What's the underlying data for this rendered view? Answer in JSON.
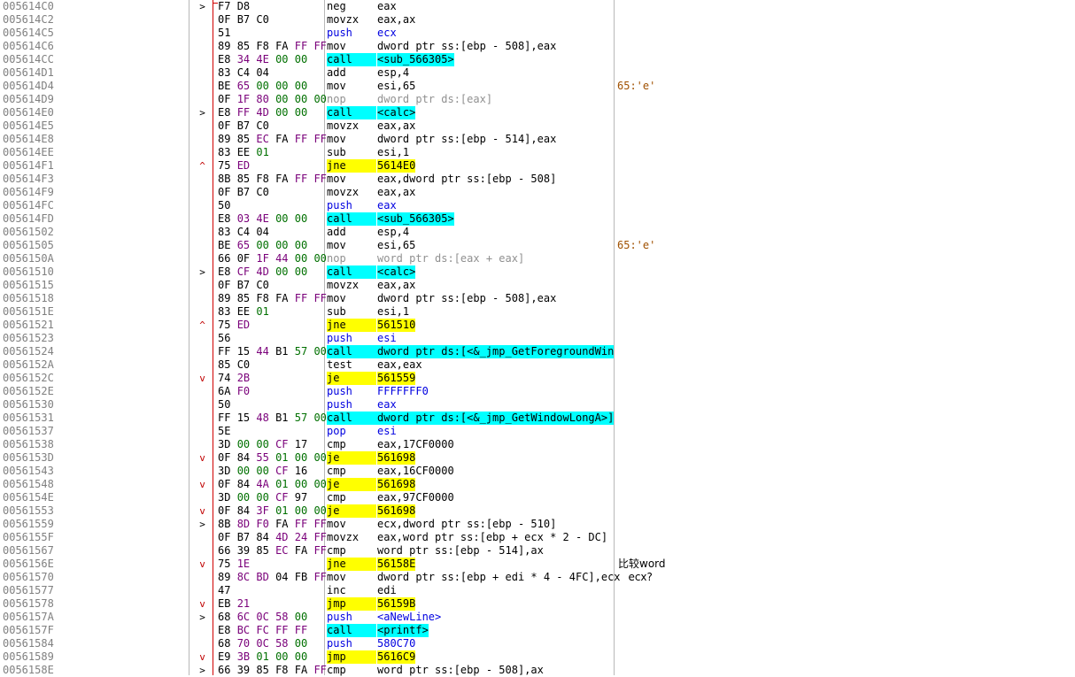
{
  "rows": [
    {
      "addr": "005614C0",
      "arrow": ">",
      "bytes": "F7 D8",
      "mnem": "neg",
      "ops": "eax",
      "comment": ""
    },
    {
      "addr": "005614C2",
      "arrow": "",
      "bytes": "0F B7 C0",
      "mnem": "movzx",
      "ops": "eax,ax",
      "comment": ""
    },
    {
      "addr": "005614C5",
      "arrow": "",
      "bytes": "51",
      "mnem": "push",
      "ops": "ecx",
      "comment": ""
    },
    {
      "addr": "005614C6",
      "arrow": "",
      "bytes": "89 85 F8 FA FF FF",
      "mnem": "mov",
      "ops": "dword ptr ss:[ebp - 508],eax",
      "comment": ""
    },
    {
      "addr": "005614CC",
      "arrow": "",
      "bytes": "E8 34 4E 00 00",
      "mnem": "call",
      "ops": "<sub_566305>",
      "comment": ""
    },
    {
      "addr": "005614D1",
      "arrow": "",
      "bytes": "83 C4 04",
      "mnem": "add",
      "ops": "esp,4",
      "comment": ""
    },
    {
      "addr": "005614D4",
      "arrow": "",
      "bytes": "BE 65 00 00 00",
      "mnem": "mov",
      "ops": "esi,65",
      "comment": "65:'e'"
    },
    {
      "addr": "005614D9",
      "arrow": "",
      "bytes": "0F 1F 80 00 00 00",
      "mnem": "nop",
      "ops": "dword ptr ds:[eax]",
      "comment": ""
    },
    {
      "addr": "005614E0",
      "arrow": ">",
      "bytes": "E8 FF 4D 00 00",
      "mnem": "call",
      "ops": "<calc>",
      "comment": ""
    },
    {
      "addr": "005614E5",
      "arrow": "",
      "bytes": "0F B7 C0",
      "mnem": "movzx",
      "ops": "eax,ax",
      "comment": ""
    },
    {
      "addr": "005614E8",
      "arrow": "",
      "bytes": "89 85 EC FA FF FF",
      "mnem": "mov",
      "ops": "dword ptr ss:[ebp - 514],eax",
      "comment": ""
    },
    {
      "addr": "005614EE",
      "arrow": "",
      "bytes": "83 EE 01",
      "mnem": "sub",
      "ops": "esi,1",
      "comment": ""
    },
    {
      "addr": "005614F1",
      "arrow": "^",
      "bytes": "75 ED",
      "mnem": "jne",
      "ops": "5614E0",
      "comment": ""
    },
    {
      "addr": "005614F3",
      "arrow": "",
      "bytes": "8B 85 F8 FA FF FF",
      "mnem": "mov",
      "ops": "eax,dword ptr ss:[ebp - 508]",
      "comment": ""
    },
    {
      "addr": "005614F9",
      "arrow": "",
      "bytes": "0F B7 C0",
      "mnem": "movzx",
      "ops": "eax,ax",
      "comment": ""
    },
    {
      "addr": "005614FC",
      "arrow": "",
      "bytes": "50",
      "mnem": "push",
      "ops": "eax",
      "comment": ""
    },
    {
      "addr": "005614FD",
      "arrow": "",
      "bytes": "E8 03 4E 00 00",
      "mnem": "call",
      "ops": "<sub_566305>",
      "comment": ""
    },
    {
      "addr": "00561502",
      "arrow": "",
      "bytes": "83 C4 04",
      "mnem": "add",
      "ops": "esp,4",
      "comment": ""
    },
    {
      "addr": "00561505",
      "arrow": "",
      "bytes": "BE 65 00 00 00",
      "mnem": "mov",
      "ops": "esi,65",
      "comment": "65:'e'"
    },
    {
      "addr": "0056150A",
      "arrow": "",
      "bytes": "66 0F 1F 44 00 00",
      "mnem": "nop",
      "ops": "word ptr ds:[eax + eax]",
      "comment": ""
    },
    {
      "addr": "00561510",
      "arrow": ">",
      "bytes": "E8 CF 4D 00 00",
      "mnem": "call",
      "ops": "<calc>",
      "comment": ""
    },
    {
      "addr": "00561515",
      "arrow": "",
      "bytes": "0F B7 C0",
      "mnem": "movzx",
      "ops": "eax,ax",
      "comment": ""
    },
    {
      "addr": "00561518",
      "arrow": "",
      "bytes": "89 85 F8 FA FF FF",
      "mnem": "mov",
      "ops": "dword ptr ss:[ebp - 508],eax",
      "comment": ""
    },
    {
      "addr": "0056151E",
      "arrow": "",
      "bytes": "83 EE 01",
      "mnem": "sub",
      "ops": "esi,1",
      "comment": ""
    },
    {
      "addr": "00561521",
      "arrow": "^",
      "bytes": "75 ED",
      "mnem": "jne",
      "ops": "561510",
      "comment": ""
    },
    {
      "addr": "00561523",
      "arrow": "",
      "bytes": "56",
      "mnem": "push",
      "ops": "esi",
      "comment": ""
    },
    {
      "addr": "00561524",
      "arrow": "",
      "bytes": "FF 15 44 B1 57 00",
      "mnem": "call",
      "ops": "dword ptr ds:[<&_jmp_GetForegroundWindow>]",
      "comment": ""
    },
    {
      "addr": "0056152A",
      "arrow": "",
      "bytes": "85 C0",
      "mnem": "test",
      "ops": "eax,eax",
      "comment": ""
    },
    {
      "addr": "0056152C",
      "arrow": "v",
      "bytes": "74 2B",
      "mnem": "je",
      "ops": "561559",
      "comment": ""
    },
    {
      "addr": "0056152E",
      "arrow": "",
      "bytes": "6A F0",
      "mnem": "push",
      "ops": "FFFFFFF0",
      "comment": ""
    },
    {
      "addr": "00561530",
      "arrow": "",
      "bytes": "50",
      "mnem": "push",
      "ops": "eax",
      "comment": ""
    },
    {
      "addr": "00561531",
      "arrow": "",
      "bytes": "FF 15 48 B1 57 00",
      "mnem": "call",
      "ops": "dword ptr ds:[<&_jmp_GetWindowLongA>]",
      "comment": ""
    },
    {
      "addr": "00561537",
      "arrow": "",
      "bytes": "5E",
      "mnem": "pop",
      "ops": "esi",
      "comment": ""
    },
    {
      "addr": "00561538",
      "arrow": "",
      "bytes": "3D 00 00 CF 17",
      "mnem": "cmp",
      "ops": "eax,17CF0000",
      "comment": ""
    },
    {
      "addr": "0056153D",
      "arrow": "v",
      "bytes": "0F 84 55 01 00 00",
      "mnem": "je",
      "ops": "561698",
      "comment": ""
    },
    {
      "addr": "00561543",
      "arrow": "",
      "bytes": "3D 00 00 CF 16",
      "mnem": "cmp",
      "ops": "eax,16CF0000",
      "comment": ""
    },
    {
      "addr": "00561548",
      "arrow": "v",
      "bytes": "0F 84 4A 01 00 00",
      "mnem": "je",
      "ops": "561698",
      "comment": ""
    },
    {
      "addr": "0056154E",
      "arrow": "",
      "bytes": "3D 00 00 CF 97",
      "mnem": "cmp",
      "ops": "eax,97CF0000",
      "comment": ""
    },
    {
      "addr": "00561553",
      "arrow": "v",
      "bytes": "0F 84 3F 01 00 00",
      "mnem": "je",
      "ops": "561698",
      "comment": ""
    },
    {
      "addr": "00561559",
      "arrow": ">",
      "bytes": "8B 8D F0 FA FF FF",
      "mnem": "mov",
      "ops": "ecx,dword ptr ss:[ebp - 510]",
      "comment": ""
    },
    {
      "addr": "0056155F",
      "arrow": "",
      "bytes": "0F B7 84 4D 24 FF",
      "mnem": "movzx",
      "ops": "eax,word ptr ss:[ebp + ecx * 2 - DC]",
      "comment": ""
    },
    {
      "addr": "00561567",
      "arrow": "",
      "bytes": "66 39 85 EC FA FF",
      "mnem": "cmp",
      "ops": "word ptr ss:[ebp - 514],ax",
      "comment": ""
    },
    {
      "addr": "0056156E",
      "arrow": "v",
      "bytes": "75 1E",
      "mnem": "jne",
      "ops": "56158E",
      "comment": "比较word",
      "commentCn": true
    },
    {
      "addr": "00561570",
      "arrow": "",
      "bytes": "89 8C BD 04 FB FF",
      "mnem": "mov",
      "ops": "dword ptr ss:[ebp + edi * 4 - 4FC],ecx",
      "comment": "   ecx?",
      "commentCn": true
    },
    {
      "addr": "00561577",
      "arrow": "",
      "bytes": "47",
      "mnem": "inc",
      "ops": "edi",
      "comment": ""
    },
    {
      "addr": "00561578",
      "arrow": "v",
      "bytes": "EB 21",
      "mnem": "jmp",
      "ops": "56159B",
      "comment": ""
    },
    {
      "addr": "0056157A",
      "arrow": ">",
      "bytes": "68 6C 0C 58 00",
      "mnem": "push",
      "ops": "<aNewLine>",
      "comment": ""
    },
    {
      "addr": "0056157F",
      "arrow": "",
      "bytes": "E8 BC FC FF FF",
      "mnem": "call",
      "ops": "<printf>",
      "comment": ""
    },
    {
      "addr": "00561584",
      "arrow": "",
      "bytes": "68 70 0C 58 00",
      "mnem": "push",
      "ops": "580C70",
      "comment": ""
    },
    {
      "addr": "00561589",
      "arrow": "v",
      "bytes": "E9 3B 01 00 00",
      "mnem": "jmp",
      "ops": "5616C9",
      "comment": ""
    },
    {
      "addr": "0056158E",
      "arrow": ">",
      "bytes": "66 39 85 F8 FA FF",
      "mnem": "cmp",
      "ops": "word ptr ss:[ebp - 508],ax",
      "comment": ""
    }
  ]
}
